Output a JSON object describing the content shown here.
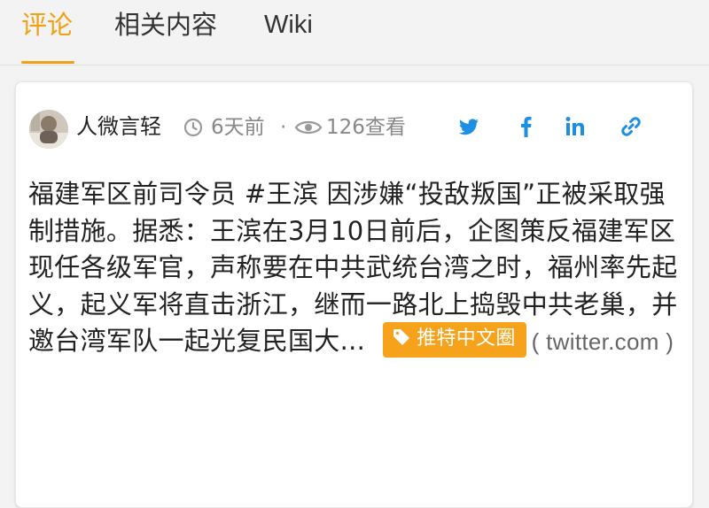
{
  "tabs": [
    {
      "label": "评论",
      "active": true
    },
    {
      "label": "相关内容",
      "active": false
    },
    {
      "label": "Wiki",
      "active": false
    }
  ],
  "post": {
    "author": "人微言轻",
    "time_ago": "6天前",
    "separator": "·",
    "views": "126查看",
    "share_icons": [
      "twitter-icon",
      "facebook-icon",
      "linkedin-icon",
      "link-icon"
    ],
    "body": "福建军区前司令员 #王滨 因涉嫌“投敌叛国”正被采取强制措施。据悉：王滨在3月10日前后，企图策反福建军区现任各级军官，声称要在中共武统台湾之时，福州率先起义，起义军将直击浙江，继而一路北上捣毁中共老巢，并邀台湾军队一起光复民国大...",
    "source_label": "推特中文圈",
    "source_domain": "( twitter.com )"
  },
  "colors": {
    "accent": "#f0a012",
    "badge": "#f6a21b",
    "share_blue": "#1d8fe1",
    "muted": "#888888"
  }
}
